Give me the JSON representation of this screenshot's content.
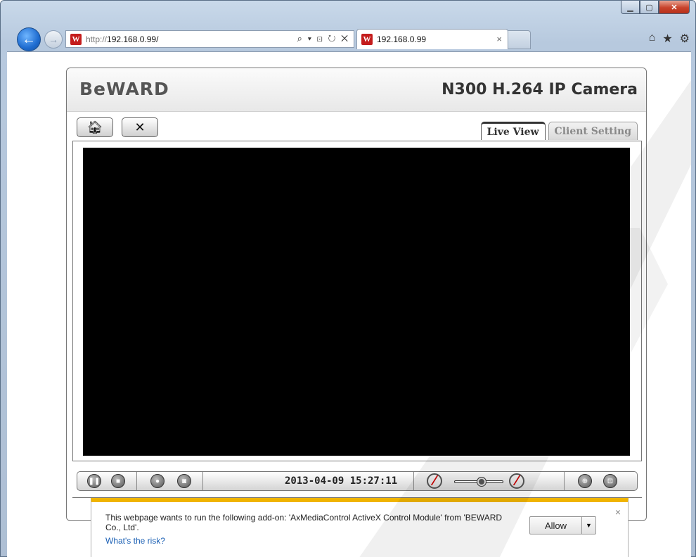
{
  "browser": {
    "url_prefix": "http://",
    "url_host": "192.168.0.99/",
    "address_tools": "⌕ ▾ ⊡ ↻ ✕",
    "tab_title": "192.168.0.99",
    "tab_close": "×",
    "site_icon": "W",
    "window_min": "▁",
    "window_max": "▢",
    "window_close": "✕",
    "right_icons": [
      "home-icon",
      "star-icon",
      "gear-icon"
    ]
  },
  "camera": {
    "brand": "BeWARD",
    "model": "N300 H.264 IP Camera",
    "tabs": [
      {
        "label": "Live View",
        "active": true
      },
      {
        "label": "Client Setting",
        "active": false
      }
    ],
    "timestamp": "2013-04-09 15:27:11",
    "volume_level": 0.55
  },
  "notification": {
    "message": "This webpage wants to run the following add-on: 'AxMediaControl ActiveX Control Module' from 'BEWARD Co., Ltd'.",
    "link": "What's the risk?",
    "allow_label": "Allow",
    "close_label": "×"
  },
  "colors": {
    "accent_bar": "#f0b400",
    "mute_slash": "#cc0000",
    "brand_red": "#c41c1c"
  }
}
